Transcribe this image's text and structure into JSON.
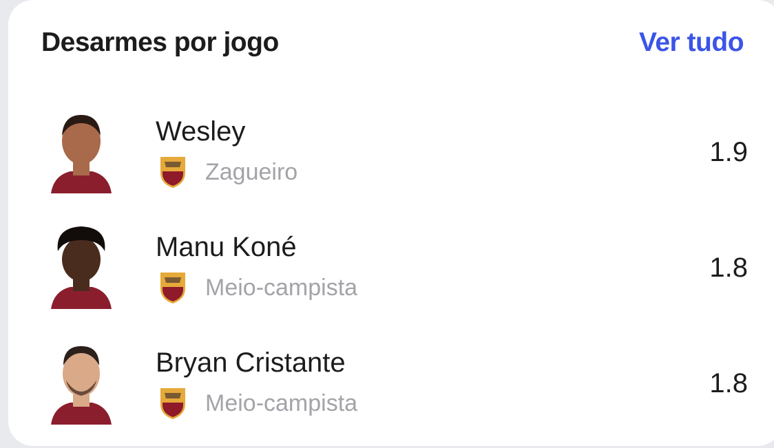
{
  "widget": {
    "title": "Desarmes por jogo",
    "see_all_label": "Ver tudo",
    "accent_color": "#3b55e6"
  },
  "players": [
    {
      "name": "Wesley",
      "position": "Zagueiro",
      "value": "1.9",
      "team_crest": "as-roma-crest-icon",
      "skin": "#a86a4a",
      "hair": "#2a1a14"
    },
    {
      "name": "Manu Koné",
      "position": "Meio-campista",
      "value": "1.8",
      "team_crest": "as-roma-crest-icon",
      "skin": "#4a2c1e",
      "hair": "#120c0a"
    },
    {
      "name": "Bryan Cristante",
      "position": "Meio-campista",
      "value": "1.8",
      "team_crest": "as-roma-crest-icon",
      "skin": "#d9a988",
      "hair": "#2b201a"
    }
  ],
  "colors": {
    "jersey": "#8b1e2d",
    "crest_gold": "#e6a93a",
    "crest_red": "#8e1a2a"
  }
}
